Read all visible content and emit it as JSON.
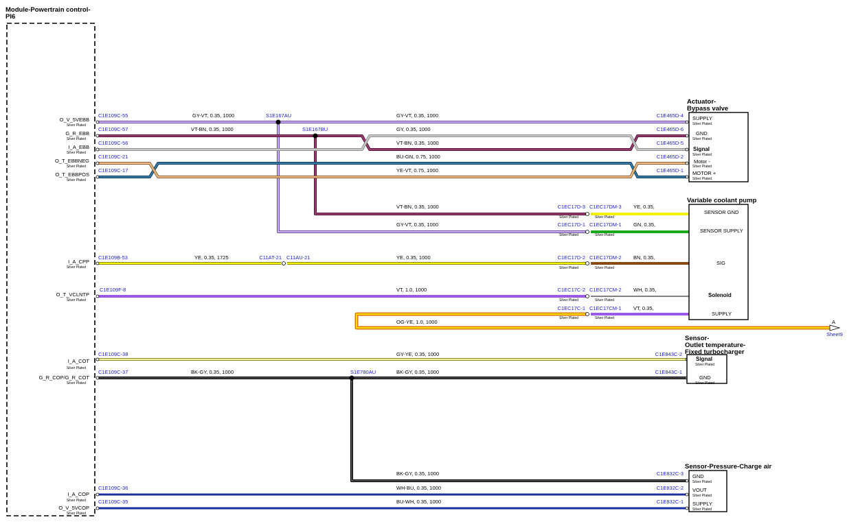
{
  "module": {
    "title_line1": "Module-Powertrain control-",
    "title_line2": "PI6",
    "silver": "Silver Plated",
    "pins": [
      {
        "name": "O_V_5VEBB"
      },
      {
        "name": "G_R_EBB"
      },
      {
        "name": "I_A_EBB"
      },
      {
        "name": "O_T_EBBNEG"
      },
      {
        "name": "O_T_EBBPOS"
      },
      {
        "name": "I_A_CPP"
      },
      {
        "name": "O_T_VCLNTP"
      },
      {
        "name": "I_A_COT"
      },
      {
        "name": "G_R_COP/G_R_COT"
      },
      {
        "name": "I_A_COP"
      },
      {
        "name": "O_V_5VCOP"
      }
    ]
  },
  "wires": [
    {
      "conn": "C1E109C-55",
      "spec1": "GY-VT,  0.35,  1000",
      "splice": "S1E167AU",
      "spec2": "GY-VT,  0.35,  1000",
      "end": "C1E465D-4",
      "color": "#a98bd6"
    },
    {
      "conn": "C1E109C-57",
      "spec1": "VT-BN,  0.35,  1000",
      "splice": "S1E167BU",
      "spec2": "GY,  0.35,  1000",
      "end": "C1E465D-6",
      "color": "#9b3a73"
    },
    {
      "conn": "C1E109C-56",
      "spec2": "VT-BN,  0.35,  1000",
      "end": "C1E465D-5",
      "color": "#b8b8b8"
    },
    {
      "conn": "C1E109C-21",
      "spec2": "BU-GN,  0.75,  1000",
      "end": "C1E465D-2",
      "color": "#2a6e9a"
    },
    {
      "conn": "C1E109C-17",
      "spec2": "YE-VT,  0.75,  1000",
      "end": "C1E465D-1",
      "color": "#d9a066"
    },
    {
      "spec2": "VT-BN,  0.35,  1000",
      "end": "C1EC17D-3",
      "end2": "C1EC17DM-3",
      "spec3": "YE,  0.35,",
      "color": "#9b3a73"
    },
    {
      "spec2": "GY-VT,  0.35,  1000",
      "end": "C1EC17D-1",
      "end2": "C1EC17DM-1",
      "spec3": "GN,  0.35,",
      "color": "#a98bd6"
    },
    {
      "conn": "C1E109B-53",
      "spec1": "YE,  0.35,  1725",
      "splice": "C11AT-21",
      "splice2": "C11AU-21",
      "spec2": "YE,  0.35,  1000",
      "end": "C1EC17D-2",
      "end2": "C1EC17DM-2",
      "spec3": "BN,  0.35,",
      "color": "#f2f000"
    },
    {
      "conn": "C1E109F-8",
      "spec2": "VT,  1.0,  1000",
      "end": "C1EC17C-2",
      "end2": "C1EC17CM-2",
      "spec3": "WH,  0.35,",
      "color": "#9b59e8"
    },
    {
      "end": "C1EC17C-1",
      "end2": "C1EC17CM-1",
      "spec3": "VT,  0.35,",
      "color": "#9b59e8"
    },
    {
      "spec2": "OG-YE,  1.0,  1000",
      "ref": "A",
      "sheet": "Sheet9",
      "color": "#f2a900"
    },
    {
      "conn": "C1E109C-38",
      "spec2": "GY-YE,  0.35,  1000",
      "end": "C1E843C-2",
      "color": "#e6e68a"
    },
    {
      "conn": "C1E109C-37",
      "spec1": "BK-GY,  0.35,  1000",
      "splice": "S1E780AU",
      "spec2": "BK-GY,  0.35,  1000",
      "end": "C1E843C-1",
      "color": "#222222"
    },
    {
      "spec2": "BK-GY,  0.35,  1000",
      "end": "C1E832C-3",
      "color": "#222222"
    },
    {
      "conn": "C1E109C-36",
      "spec2": "WH-BU,  0.35,  1000",
      "end": "C1E832C-2",
      "color": "#1b2f9e"
    },
    {
      "conn": "C1E109C-35",
      "spec2": "BU-WH,  0.35,  1000",
      "end": "C1E832C-1",
      "color": "#1b2f9e"
    }
  ],
  "components": {
    "bypass_valve": {
      "title1": "Actuator-",
      "title2": "Bypass valve",
      "pins": [
        "SUPPLY",
        "GND",
        "Signal",
        "Motor -",
        "MOTOR +"
      ]
    },
    "coolant_pump": {
      "title": "Variable coolant pump",
      "pins": [
        "SENSOR GND",
        "SENSOR SUPPLY",
        "SIG",
        "Solenoid",
        "SUPPLY"
      ]
    },
    "outlet_temp": {
      "title1": "Sensor-",
      "title2": "Outlet temperature-",
      "title3": "Fixed turbocharger",
      "pins": [
        "Signal",
        "GND"
      ]
    },
    "charge_air": {
      "title": "Sensor-Pressure-Charge air",
      "pins": [
        "GND",
        "VOUT",
        "SUPPLY"
      ]
    }
  },
  "colors": {
    "connector_text": "#1a1ad6",
    "border": "#000000"
  }
}
